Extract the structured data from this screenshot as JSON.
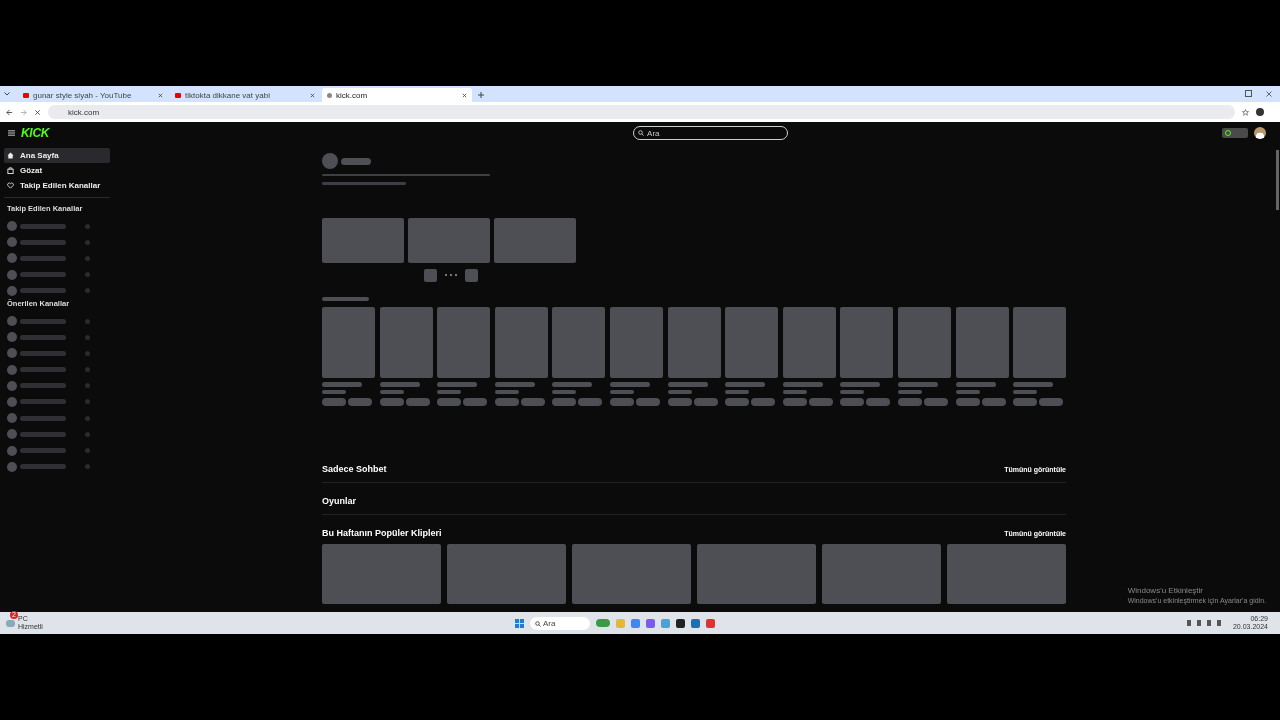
{
  "browser": {
    "tabs": [
      {
        "title": "gunar style siyah - YouTube",
        "selected": false,
        "kind": "video"
      },
      {
        "title": "tiktokta dikkane vat yabi",
        "selected": false,
        "kind": "video"
      },
      {
        "title": "kick.com",
        "selected": true,
        "kind": "site"
      }
    ],
    "address": "kick.com"
  },
  "header": {
    "logo": "KICK",
    "search": {
      "placeholder": "Ara"
    }
  },
  "sidebar": {
    "items": [
      {
        "label": "Ana Sayfa",
        "selected": true
      },
      {
        "label": "Gözat",
        "selected": false
      },
      {
        "label": "Takip Edilen Kanallar",
        "selected": false
      }
    ],
    "sections": [
      {
        "title": "Takip Edilen Kanallar"
      },
      {
        "title": "Önerilen Kanallar"
      }
    ]
  },
  "sections": [
    {
      "title": "Sadece Sohbet",
      "link": "Tümünü görüntüle"
    },
    {
      "title": "Oyunlar"
    },
    {
      "title": "Bu Haftanın Popüler Klipleri",
      "link": "Tümünü görüntüle"
    }
  ],
  "activation_notice": {
    "title": "Windows'u Etkinleştir",
    "text": "Windows'u etkinleştirmek için Ayarlar'a gidin."
  },
  "taskbar": {
    "weather": {
      "badge": "2",
      "line1": "PC",
      "line2": "Hizmetli"
    },
    "search": {
      "placeholder": "Ara"
    },
    "time": "06:29",
    "date": "20.03.2024"
  }
}
